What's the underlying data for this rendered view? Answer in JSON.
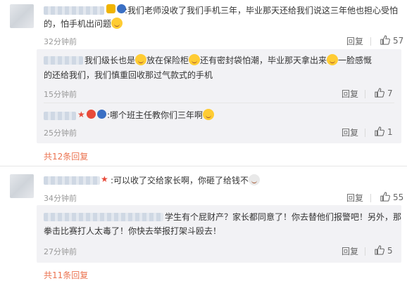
{
  "comments": [
    {
      "text_line1": ":我们老师没收了我们手机三年，毕业那天还给我们说这三年他也担心受怕",
      "text_line2": "的，怕手机出问题",
      "time": "32分钟前",
      "reply_label": "回复",
      "likes": "57",
      "replies": [
        {
          "text_line1": "我们级长也是",
          "text_seg2": "放在保险柜",
          "text_seg3": "还有密封袋怕潮，毕业那天拿出来",
          "text_seg4": "一脸感慨",
          "text_line2": "的还给我们，我们慎重回收那过气款式的手机",
          "time": "15分钟前",
          "reply_label": "回复",
          "likes": "7"
        },
        {
          "text": ":哪个班主任教你们三年啊",
          "time": "25分钟前",
          "reply_label": "回复",
          "likes": "1"
        }
      ],
      "more_label": "共12条回复"
    },
    {
      "text": ":可以收了交给家长啊，你砸了给钱不",
      "time": "34分钟前",
      "reply_label": "回复",
      "likes": "55",
      "replies": [
        {
          "text_line1": "学生有个屁财产？家长都同意了！你去替他们报警吧！另外，那",
          "text_line2": "拳击比赛打人太毒了！你快去举报打架斗殴去！",
          "time": "27分钟前",
          "reply_label": "回复",
          "likes": "5"
        }
      ],
      "more_label": "共11条回复"
    }
  ],
  "colors": {
    "accent": "#eb7350",
    "sub_bg": "#f2f2f5",
    "text": "#333333",
    "muted": "#999999"
  },
  "icons": {
    "like": "thumbs-up-icon",
    "emoji": "smiley-icon"
  }
}
